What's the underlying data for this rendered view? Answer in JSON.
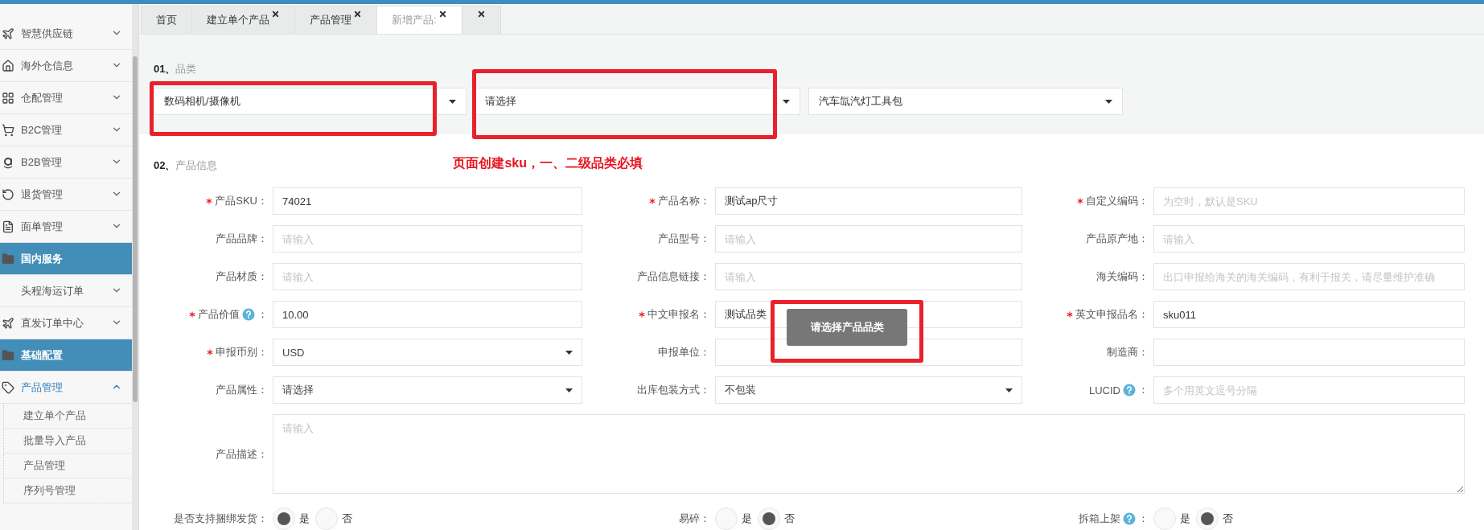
{
  "sidebar": {
    "items": [
      {
        "kind": "group",
        "label": "智慧供应链",
        "expanded": false
      },
      {
        "kind": "group",
        "label": "海外仓信息",
        "expanded": false
      },
      {
        "kind": "group",
        "label": "仓配管理",
        "expanded": false
      },
      {
        "kind": "group",
        "label": "B2C管理",
        "expanded": false
      },
      {
        "kind": "group",
        "label": "B2B管理",
        "expanded": false
      },
      {
        "kind": "group",
        "label": "退货管理",
        "expanded": false
      },
      {
        "kind": "group",
        "label": "面单管理",
        "expanded": false
      },
      {
        "kind": "section",
        "label": "国内服务"
      },
      {
        "kind": "group",
        "label": "头程海运订单",
        "expanded": false
      },
      {
        "kind": "group",
        "label": "直发订单中心",
        "expanded": false
      },
      {
        "kind": "section",
        "label": "基础配置"
      },
      {
        "kind": "group",
        "label": "产品管理",
        "expanded": true,
        "children": [
          {
            "label": "建立单个产品"
          },
          {
            "label": "批量导入产品"
          },
          {
            "label": "产品管理"
          },
          {
            "label": "序列号管理"
          }
        ]
      }
    ]
  },
  "tabs": [
    {
      "label": "首页",
      "closable": false,
      "selected": false
    },
    {
      "label": "建立单个产品",
      "closable": true,
      "selected": false
    },
    {
      "label": "产品管理",
      "closable": true,
      "selected": false
    },
    {
      "label": "新增产品:",
      "closable": true,
      "selected": true
    },
    {
      "closable": true,
      "selected": false
    }
  ],
  "category": {
    "number": "01、",
    "title": "品类",
    "selects": [
      {
        "value": "数码相机/摄像机"
      },
      {
        "value": "请选择"
      },
      {
        "value": "汽车氙汽灯工具包"
      }
    ]
  },
  "product_info": {
    "number": "02、",
    "title": "产品信息",
    "note": "页面创建sku，一、二级品类必填",
    "fields": [
      {
        "kind": "input",
        "label": "产品SKU：",
        "required": true,
        "value": "74021"
      },
      {
        "kind": "input",
        "label": "产品名称：",
        "required": true,
        "value": "测试ap尺寸"
      },
      {
        "kind": "input",
        "label": "自定义编码：",
        "required": true,
        "placeholder": "为空时，默认是SKU"
      },
      {
        "kind": "input",
        "label": "产品品牌：",
        "required": false,
        "placeholder": "请输入"
      },
      {
        "kind": "input",
        "label": "产品型号：",
        "required": false,
        "placeholder": "请输入"
      },
      {
        "kind": "input",
        "label": "产品原产地：",
        "required": false,
        "placeholder": "请输入"
      },
      {
        "kind": "input",
        "label": "产品材质：",
        "required": false,
        "placeholder": "请输入"
      },
      {
        "kind": "input",
        "label": "产品信息链接：",
        "required": false,
        "placeholder": "请输入"
      },
      {
        "kind": "input",
        "label": "海关编码：",
        "required": false,
        "placeholder": "出口申报给海关的海关编码，有利于报关，请尽量维护准确"
      },
      {
        "kind": "input",
        "label": "产品价值",
        "help": true,
        "colon": "：",
        "required": true,
        "value": "10.00"
      },
      {
        "kind": "input",
        "label": "中文申报名：",
        "required": true,
        "value": "测试品类"
      },
      {
        "kind": "input",
        "label": "英文申报品名：",
        "required": true,
        "value": "sku011"
      },
      {
        "kind": "select",
        "label": "申报币别：",
        "required": true,
        "value": "USD"
      },
      {
        "kind": "input",
        "label": "申报单位：",
        "required": false
      },
      {
        "kind": "input",
        "label": "制造商：",
        "required": false
      },
      {
        "kind": "select",
        "label": "产品属性：",
        "required": false,
        "value": "请选择"
      },
      {
        "kind": "select",
        "label": "出库包装方式：",
        "required": false,
        "value": "不包装"
      },
      {
        "kind": "input",
        "label": "LUCID",
        "help": true,
        "colon": "：",
        "required": false,
        "placeholder": "多个用英文逗号分隔"
      }
    ],
    "description": {
      "label": "产品描述：",
      "placeholder": "请输入"
    },
    "radios": [
      {
        "label": "是否支持捆绑发货：",
        "options": [
          {
            "label": "是",
            "selected": true
          },
          {
            "label": "否",
            "selected": false
          }
        ]
      },
      {
        "label": "易碎：",
        "options": [
          {
            "label": "是",
            "selected": false
          },
          {
            "label": "否",
            "selected": true
          }
        ]
      },
      {
        "label": "拆箱上架",
        "help": true,
        "colon": "：",
        "options": [
          {
            "label": "是",
            "selected": false
          },
          {
            "label": "否",
            "selected": true
          }
        ]
      }
    ]
  },
  "toast": {
    "message": "请选择产品品类"
  }
}
